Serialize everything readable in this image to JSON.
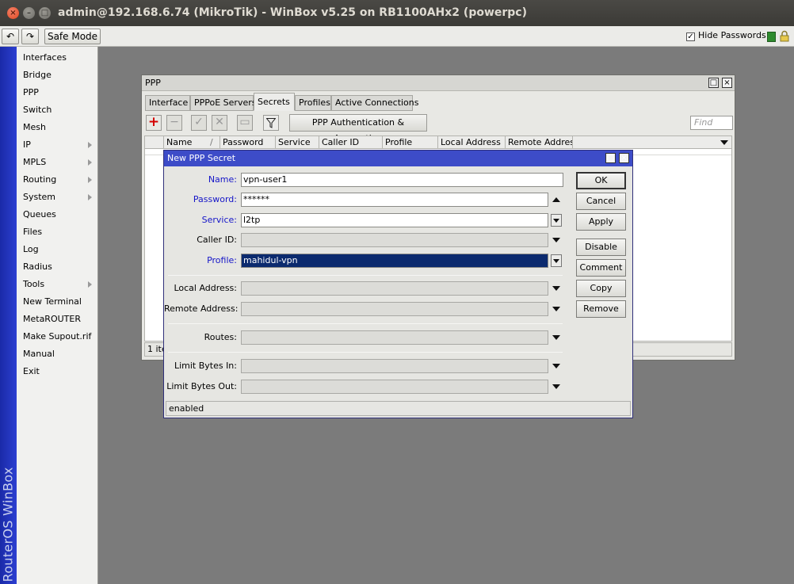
{
  "window": {
    "title": "admin@192.168.6.74 (MikroTik) - WinBox v5.25 on RB1100AHx2 (powerpc)",
    "close_glyph": "×",
    "min_glyph": "–",
    "max_glyph": "□"
  },
  "toolbar": {
    "undo_glyph": "↶",
    "redo_glyph": "↷",
    "safe_mode_label": "Safe Mode",
    "hide_passwords_label": "Hide Passwords",
    "hide_passwords_checked_glyph": "✓"
  },
  "sidebar": {
    "brand": "RouterOS WinBox",
    "items": [
      {
        "label": "Interfaces"
      },
      {
        "label": "Bridge"
      },
      {
        "label": "PPP"
      },
      {
        "label": "Switch"
      },
      {
        "label": "Mesh"
      },
      {
        "label": "IP"
      },
      {
        "label": "MPLS"
      },
      {
        "label": "Routing"
      },
      {
        "label": "System"
      },
      {
        "label": "Queues"
      },
      {
        "label": "Files"
      },
      {
        "label": "Log"
      },
      {
        "label": "Radius"
      },
      {
        "label": "Tools"
      },
      {
        "label": "New Terminal"
      },
      {
        "label": "MetaROUTER"
      },
      {
        "label": "Make Supout.rif"
      },
      {
        "label": "Manual"
      },
      {
        "label": "Exit"
      }
    ]
  },
  "ppp": {
    "title": "PPP",
    "tabs": [
      "Interface",
      "PPPoE Servers",
      "Secrets",
      "Profiles",
      "Active Connections"
    ],
    "auth_button": "PPP Authentication & Accounting",
    "find_placeholder": "Find",
    "columns": [
      "Name",
      "Password",
      "Service",
      "Caller ID",
      "Profile",
      "Local Address",
      "Remote Address"
    ],
    "sort_glyph": "/",
    "status": "1 ite"
  },
  "dialog": {
    "title": "New PPP Secret",
    "fields": {
      "name": {
        "label": "Name:",
        "value": "vpn-user1"
      },
      "password": {
        "label": "Password:",
        "value": "******"
      },
      "service": {
        "label": "Service:",
        "value": "l2tp"
      },
      "caller_id": {
        "label": "Caller ID:",
        "value": ""
      },
      "profile": {
        "label": "Profile:",
        "value": "mahidul-vpn"
      },
      "local_address": {
        "label": "Local Address:",
        "value": ""
      },
      "remote_address": {
        "label": "Remote Address:",
        "value": ""
      },
      "routes": {
        "label": "Routes:",
        "value": ""
      },
      "limit_bytes_in": {
        "label": "Limit Bytes In:",
        "value": ""
      },
      "limit_bytes_out": {
        "label": "Limit Bytes Out:",
        "value": ""
      }
    },
    "buttons": {
      "ok": "OK",
      "cancel": "Cancel",
      "apply": "Apply",
      "disable": "Disable",
      "comment": "Comment",
      "copy": "Copy",
      "remove": "Remove"
    },
    "status": "enabled"
  },
  "colors": {
    "dialog_title": "#3d4cc8",
    "field_label_required": "#1515c8",
    "brand_strip": "#1a2aa8",
    "selection": "#0b2a6e"
  }
}
